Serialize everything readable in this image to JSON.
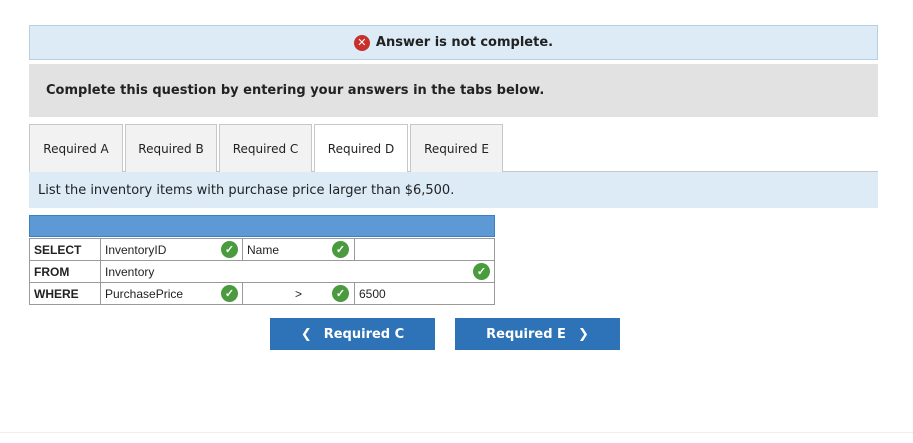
{
  "banner": {
    "icon": "x-circle-icon",
    "text": "Answer is not complete."
  },
  "instruction": "Complete this question by entering your answers in the tabs below.",
  "tabs": [
    {
      "label": "Required A",
      "active": false
    },
    {
      "label": "Required B",
      "active": false
    },
    {
      "label": "Required C",
      "active": false
    },
    {
      "label": "Required D",
      "active": true
    },
    {
      "label": "Required E",
      "active": false
    }
  ],
  "question": "List the inventory items with purchase price larger than $6,500.",
  "sql": {
    "rows": [
      {
        "keyword": "SELECT",
        "col1": "InventoryID",
        "col2": "Name",
        "col3": ""
      },
      {
        "keyword": "FROM",
        "col1": "Inventory",
        "col2": "",
        "col3": ""
      },
      {
        "keyword": "WHERE",
        "col1": "PurchasePrice",
        "col2": ">",
        "col3": "6500"
      }
    ]
  },
  "nav": {
    "prev": "Required C",
    "next": "Required E"
  },
  "colors": {
    "error": "#c8302c",
    "check": "#4a9a3e",
    "button": "#2e73b8",
    "gridHeader": "#5d9ad5"
  }
}
